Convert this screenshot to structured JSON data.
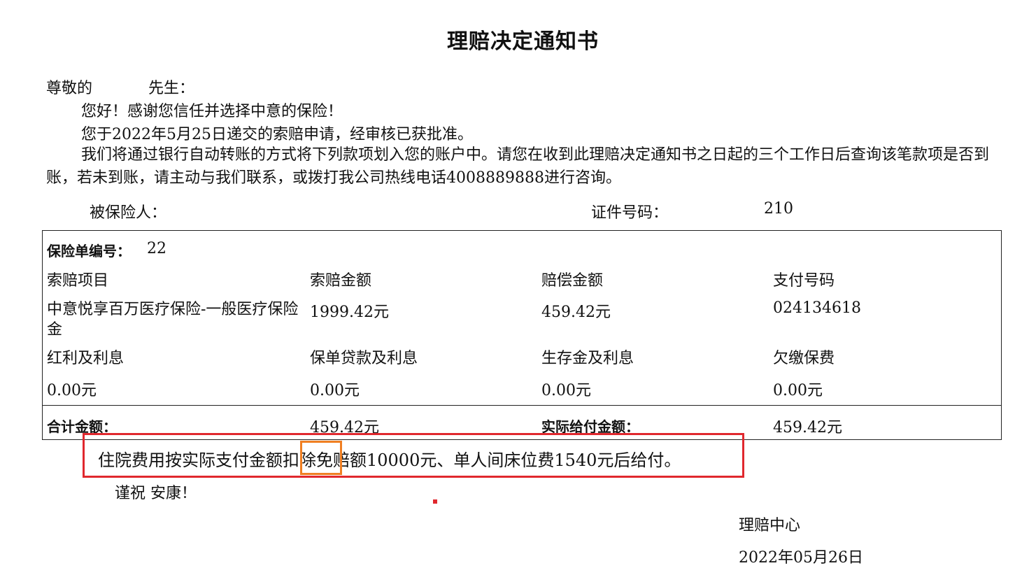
{
  "title": "理赔决定通知书",
  "salutation": {
    "prefix": "尊敬的",
    "suffix": "先生："
  },
  "greeting": "您好！感谢您信任并选择中意的保险！",
  "submission": "您于2022年5月25日递交的索赔申请，经审核已获批准。",
  "notice": "我们将通过银行自动转账的方式将下列款项划入您的账户中。请您在收到此理赔决定通知书之日起的三个工作日后查询该笔款项是否到账，若未到账，请主动与我们联系，或拨打我公司热线电话4008889888进行咨询。",
  "insured_label": "被保险人：",
  "id_label": "证件号码：",
  "id_value": "210",
  "table": {
    "policy_label": "保险单编号：",
    "policy_value": "22",
    "headers": [
      "索赔项目",
      "索赔金额",
      "赔偿金额",
      "支付号码"
    ],
    "row1": [
      "中意悦享百万医疗保险-一般医疗保险金",
      "1999.42元",
      "459.42元",
      "024134618"
    ],
    "headers2": [
      "红利及利息",
      "保单贷款及利息",
      "生存金及利息",
      "欠缴保费"
    ],
    "row2": [
      "0.00元",
      "0.00元",
      "0.00元",
      "0.00元"
    ],
    "total_label": "合计金额：",
    "total_value": "459.42元",
    "actual_label": "实际给付金额：",
    "actual_value": "459.42元"
  },
  "remark": {
    "before": "住院费用按实际支付金额",
    "highlight": "扣除",
    "after": "免赔额10000元、单人间床位费1540元后给付。"
  },
  "closing": "谨祝 安康！",
  "signature": "理赔中心",
  "date": "2022年05月26日",
  "colors": {
    "annotation_red": "#e0282e",
    "annotation_orange": "#f07f22"
  }
}
